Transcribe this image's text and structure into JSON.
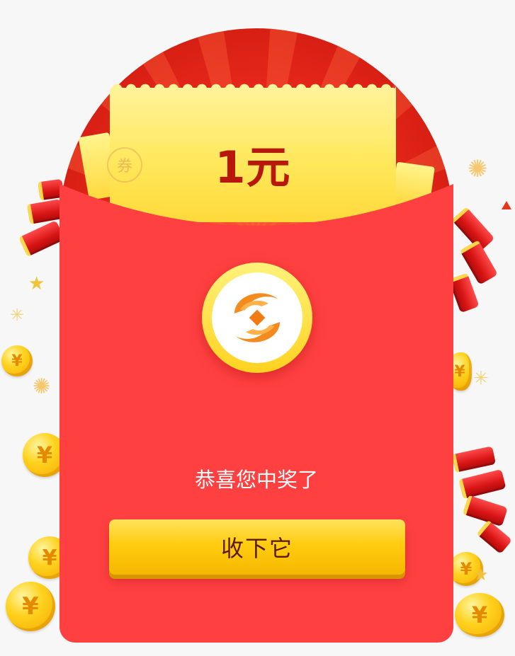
{
  "ticket": {
    "amount": "1元",
    "stamp_glyph": "券"
  },
  "logo": {
    "icon": "sync-coin-logo-icon"
  },
  "message": "恭喜您中奖了",
  "claim_button_label": "收下它",
  "decorations": {
    "coin_symbol": "¥",
    "icons": [
      "firecracker-icon",
      "gold-coin-icon",
      "sparkle-icon",
      "star-icon"
    ]
  },
  "colors": {
    "envelope": "#ff4040",
    "envelope_cap": "#d81c0e",
    "ticket": "#ffe85c",
    "amount": "#b8170c",
    "button": "#ffcc10",
    "button_text": "#5a1a06"
  }
}
